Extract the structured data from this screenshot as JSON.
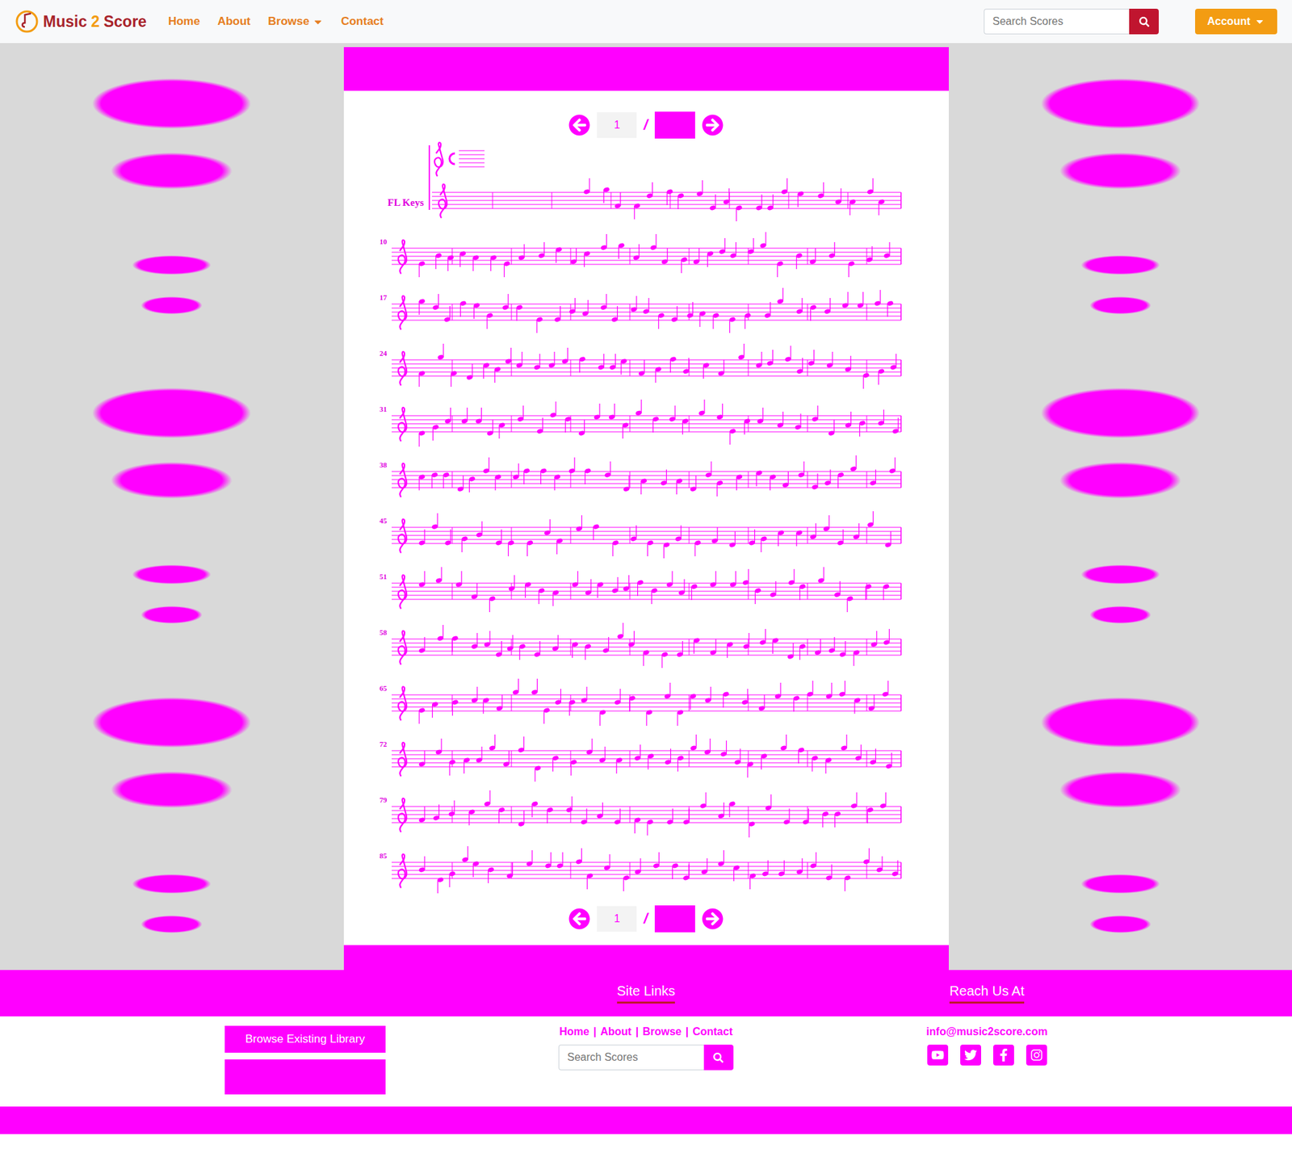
{
  "brand": {
    "parts": [
      "Music",
      "2",
      "Score"
    ]
  },
  "nav": {
    "links": [
      {
        "label": "Home",
        "dropdown": false
      },
      {
        "label": "About",
        "dropdown": false
      },
      {
        "label": "Browse",
        "dropdown": true
      },
      {
        "label": "Contact",
        "dropdown": false
      }
    ],
    "search": {
      "placeholder": "Search Scores"
    },
    "account": {
      "label": "Account"
    }
  },
  "viewer": {
    "pager_top": {
      "page": "1",
      "separator": "/"
    },
    "pager_bottom": {
      "page": "1",
      "separator": "/"
    }
  },
  "score": {
    "instrument": "FL Keys",
    "measure_numbers": [
      "10",
      "17",
      "24",
      "31",
      "38",
      "45",
      "51",
      "58",
      "65",
      "72",
      "79",
      "85"
    ]
  },
  "footer": {
    "headings": [
      "Site Links",
      "Reach Us At"
    ],
    "buttons": [
      "Browse Existing Library",
      ""
    ],
    "links": [
      "Home",
      "About",
      "Browse",
      "Contact"
    ],
    "separator": "|",
    "search": {
      "placeholder": "Search Scores"
    },
    "email": "info@music2score.com",
    "socials": [
      "youtube",
      "twitter",
      "facebook",
      "instagram"
    ]
  }
}
